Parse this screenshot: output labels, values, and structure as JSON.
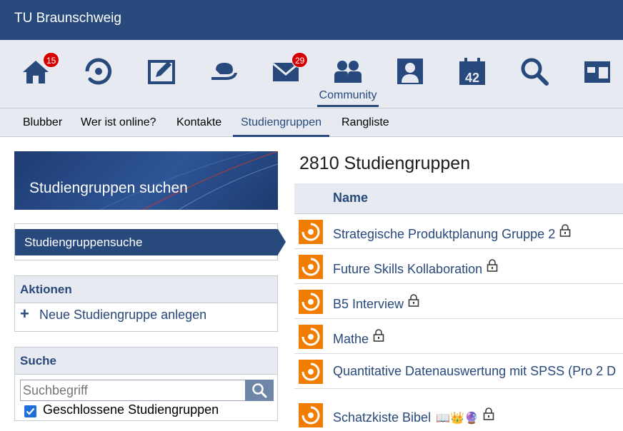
{
  "header": {
    "title": "TU Braunschweig"
  },
  "iconnav": {
    "items": [
      {
        "icon": "home-icon",
        "badge": "15"
      },
      {
        "icon": "activity-icon"
      },
      {
        "icon": "courses-icon"
      },
      {
        "icon": "coffee-icon"
      },
      {
        "icon": "mail-icon",
        "badge": "29"
      },
      {
        "icon": "community-icon",
        "label": "Community",
        "active": true
      },
      {
        "icon": "profile-icon"
      },
      {
        "icon": "calendar-icon",
        "text": "42"
      },
      {
        "icon": "search-icon"
      },
      {
        "icon": "tools-icon"
      }
    ]
  },
  "tabs": [
    {
      "label": "Blubber"
    },
    {
      "label": "Wer ist online?"
    },
    {
      "label": "Kontakte"
    },
    {
      "label": "Studiengruppen",
      "active": true
    },
    {
      "label": "Rangliste"
    }
  ],
  "sidebar": {
    "title": "Studiengruppen suchen",
    "nav_active": "Studiengruppensuche",
    "actions_title": "Aktionen",
    "action_new": "Neue Studiengruppe anlegen",
    "search_title": "Suche",
    "search_placeholder": "Suchbegriff",
    "checkbox_label": "Geschlossene Studiengruppen",
    "checkbox_checked": true
  },
  "main": {
    "title": "2810 Studiengruppen",
    "column_name": "Name",
    "rows": [
      {
        "name": "Strategische Produktplanung Gruppe 2",
        "locked": true
      },
      {
        "name": "Future Skills Kollaboration",
        "locked": true
      },
      {
        "name": "B5 Interview",
        "locked": true
      },
      {
        "name": "Mathe",
        "locked": true
      },
      {
        "name": "Quantitative Datenauswertung mit SPSS (Pro 2 D",
        "locked": false
      },
      {
        "name": "Schatzkiste Bibel",
        "emojis": "📖👑🔮",
        "locked": true
      }
    ]
  },
  "colors": {
    "primary": "#28497c",
    "badge": "#d60000",
    "avatar": "#f07d00"
  }
}
